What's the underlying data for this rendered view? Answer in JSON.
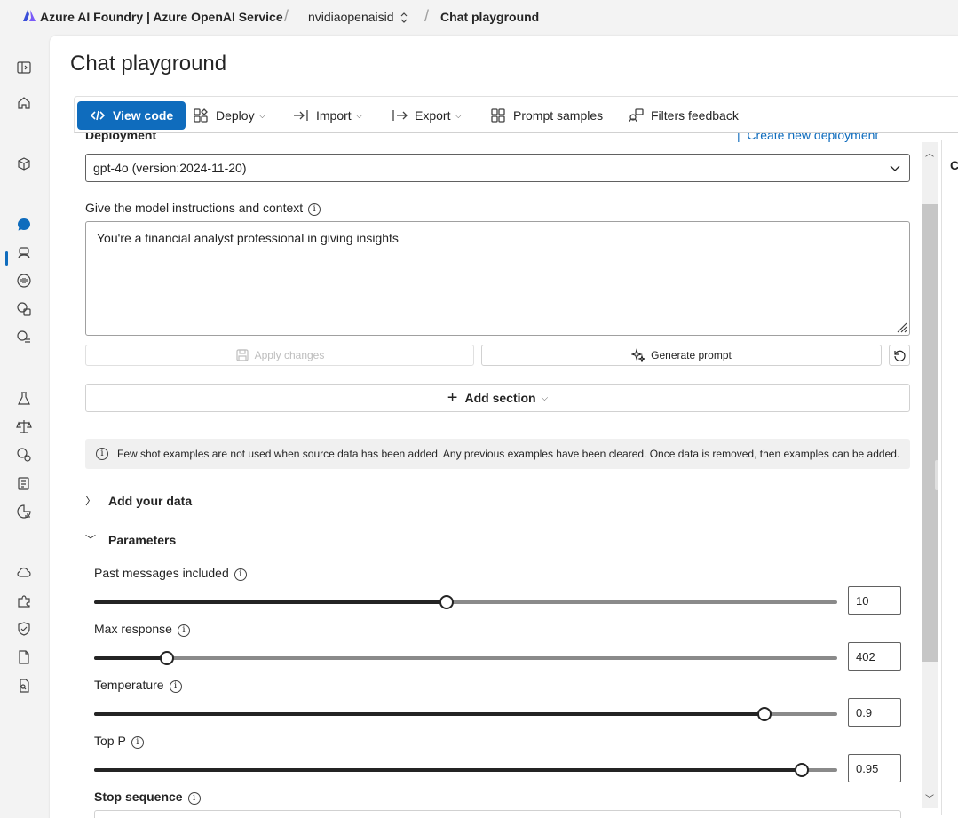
{
  "header": {
    "app_title": "Azure AI Foundry | Azure OpenAI Service",
    "resource_name": "nvidiaopenaisid",
    "breadcrumb_current": "Chat playground"
  },
  "page": {
    "title": "Chat playground"
  },
  "toolbar": {
    "view_code": "View code",
    "deploy": "Deploy",
    "import": "Import",
    "export": "Export",
    "prompt_samples": "Prompt samples",
    "filters_feedback": "Filters feedback"
  },
  "setup": {
    "deployment_label": "Deployment",
    "create_deployment_link": "Create new deployment",
    "deployment_value": "gpt-4o (version:2024-11-20)",
    "instructions_label": "Give the model instructions and context",
    "instructions_value": "You're a financial analyst professional in giving insights",
    "apply_changes": "Apply changes",
    "generate_prompt": "Generate prompt",
    "add_section": "Add section",
    "info_message": "Few shot examples are not used when source data has been added. Any previous examples have been cleared. Once data is removed, then examples can be added.",
    "add_your_data": "Add your data",
    "parameters": "Parameters"
  },
  "parameters": {
    "past_messages": {
      "label": "Past messages included",
      "value": "10",
      "fraction": 0.474
    },
    "max_response": {
      "label": "Max response",
      "value": "402",
      "fraction": 0.098
    },
    "temperature": {
      "label": "Temperature",
      "value": "0.9",
      "fraction": 0.902
    },
    "top_p": {
      "label": "Top P",
      "value": "0.95",
      "fraction": 0.952
    },
    "stop_sequence": {
      "label": "Stop sequence"
    }
  },
  "right_panel": {
    "letter": "C"
  },
  "colors": {
    "accent": "#0f6cbd",
    "text": "#242424",
    "background": "#f3f3f3"
  }
}
